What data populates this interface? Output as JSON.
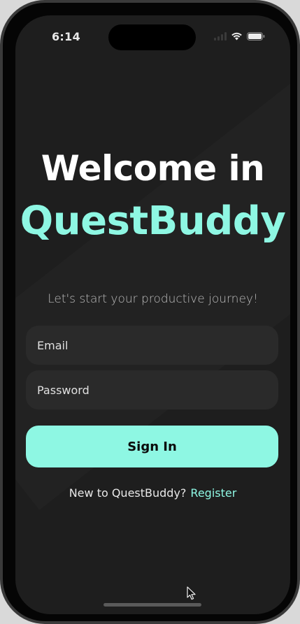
{
  "status_bar": {
    "time": "6:14",
    "icons": [
      "cellular-signal-icon",
      "wifi-icon",
      "battery-icon"
    ]
  },
  "hero": {
    "welcome": "Welcome in",
    "brand": "QuestBuddy"
  },
  "tagline": "Let's start your productive journey!",
  "form": {
    "email_placeholder": "Email",
    "password_placeholder": "Password",
    "signin_label": "Sign In"
  },
  "register": {
    "prompt": "New to QuestBuddy?",
    "link": "Register"
  },
  "colors": {
    "background": "#1e1e1e",
    "accent": "#8ef7e3",
    "field": "#2a2a2a",
    "text": "#ffffff"
  }
}
